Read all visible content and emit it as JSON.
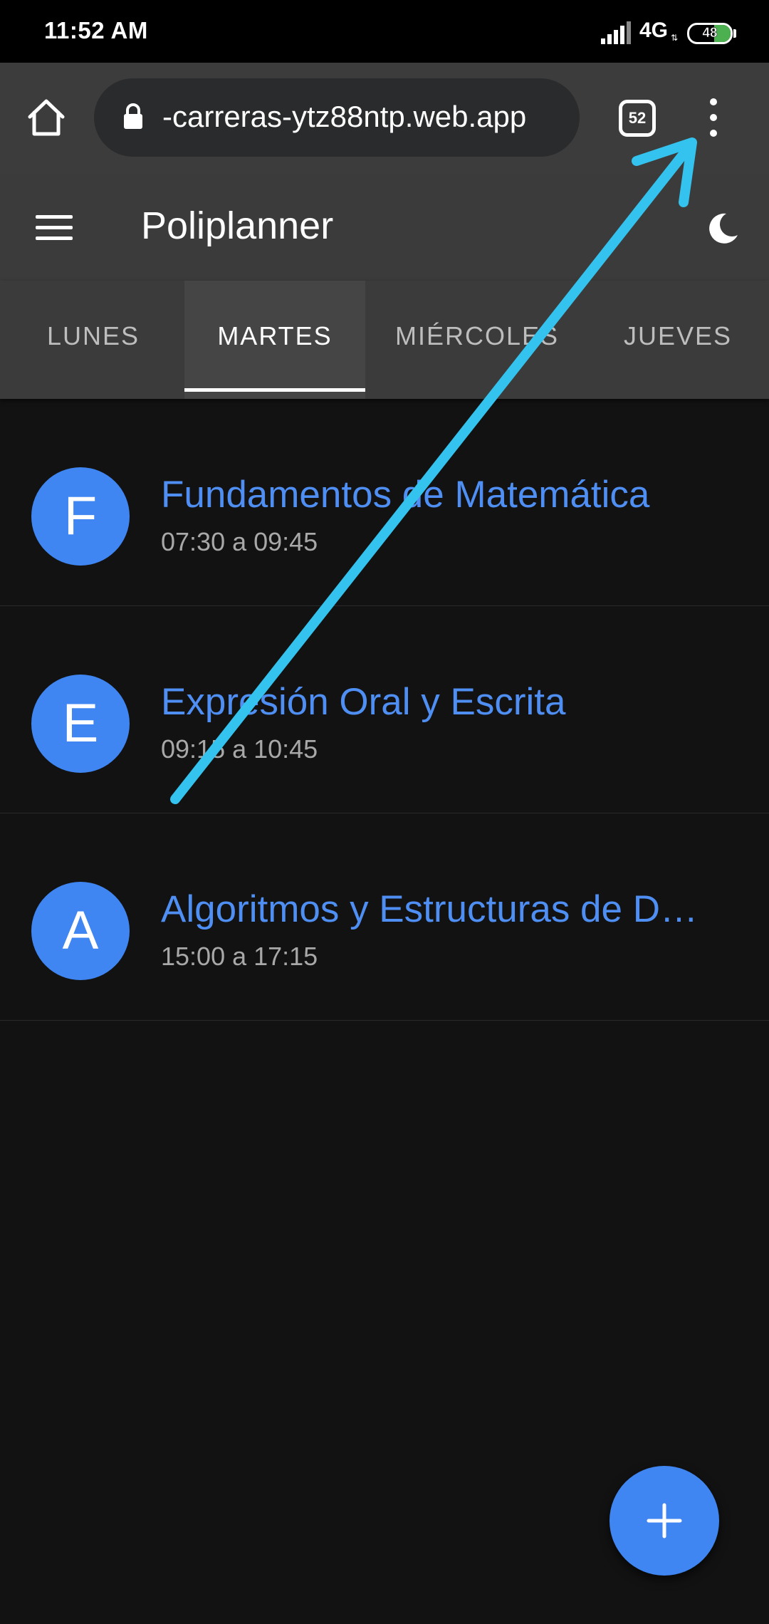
{
  "status_bar": {
    "time": "11:52 AM",
    "network": "4G",
    "battery": "48"
  },
  "browser": {
    "url": "-carreras-ytz88ntp.web.app",
    "tab_count": "52",
    "icons": [
      "home-icon",
      "lock-icon",
      "tabs-icon",
      "more-vert-icon"
    ]
  },
  "app": {
    "title": "Poliplanner",
    "icons": [
      "menu-icon",
      "dark-mode-moon-icon",
      "add-icon"
    ]
  },
  "day_tabs": [
    {
      "label": "LUNES",
      "active": false
    },
    {
      "label": "MARTES",
      "active": true
    },
    {
      "label": "MIÉRCOLES",
      "active": false
    },
    {
      "label": "JUEVES",
      "active": false
    }
  ],
  "classes": [
    {
      "initial": "F",
      "name": "Fundamentos de Matemática",
      "time": "07:30 a 09:45"
    },
    {
      "initial": "E",
      "name": "Expresión Oral y Escrita",
      "time": "09:15 a 10:45"
    },
    {
      "initial": "A",
      "name": "Algoritmos y Estructuras de D…",
      "time": "15:00 a 17:15"
    }
  ],
  "colors": {
    "accent": "#3f86f2",
    "annotation_arrow": "#33c3ee",
    "background": "#121212",
    "toolbar": "#3b3b3b"
  }
}
